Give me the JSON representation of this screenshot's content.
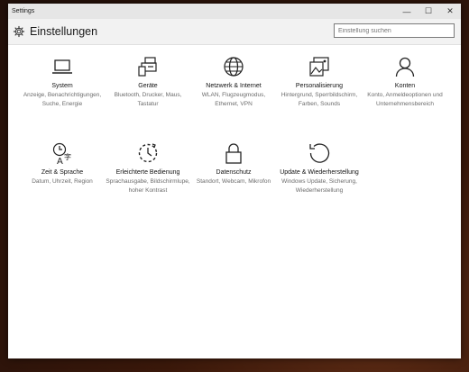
{
  "window": {
    "title": "Settings",
    "minimize": "—",
    "maximize": "☐",
    "close": "✕"
  },
  "header": {
    "title": "Einstellungen",
    "search_placeholder": "Einstellung suchen"
  },
  "tiles": [
    {
      "name": "System",
      "desc": "Anzeige, Benachrichtigungen, Suche, Energie",
      "icon": "laptop-icon"
    },
    {
      "name": "Geräte",
      "desc": "Bluetooth, Drucker, Maus, Tastatur",
      "icon": "devices-icon"
    },
    {
      "name": "Netzwerk & Internet",
      "desc": "WLAN, Flugzeugmodus, Ethernet, VPN",
      "icon": "globe-icon"
    },
    {
      "name": "Personalisierung",
      "desc": "Hintergrund, Sperrbildschirm, Farben, Sounds",
      "icon": "personalization-icon"
    },
    {
      "name": "Konten",
      "desc": "Konto, Anmeldeoptionen und Unternehmensbereich",
      "icon": "person-icon"
    },
    {
      "name": "Zeit & Sprache",
      "desc": "Datum, Uhrzeit, Region",
      "icon": "time-language-icon"
    },
    {
      "name": "Erleichterte Bedienung",
      "desc": "Sprachausgabe, Bildschirmlupe, hoher Kontrast",
      "icon": "ease-of-access-icon"
    },
    {
      "name": "Datenschutz",
      "desc": "Standort, Webcam, Mikrofon",
      "icon": "lock-icon"
    },
    {
      "name": "Update & Wiederherstellung",
      "desc": "Windows Update, Sicherung, Wiederherstellung",
      "icon": "update-icon"
    }
  ]
}
